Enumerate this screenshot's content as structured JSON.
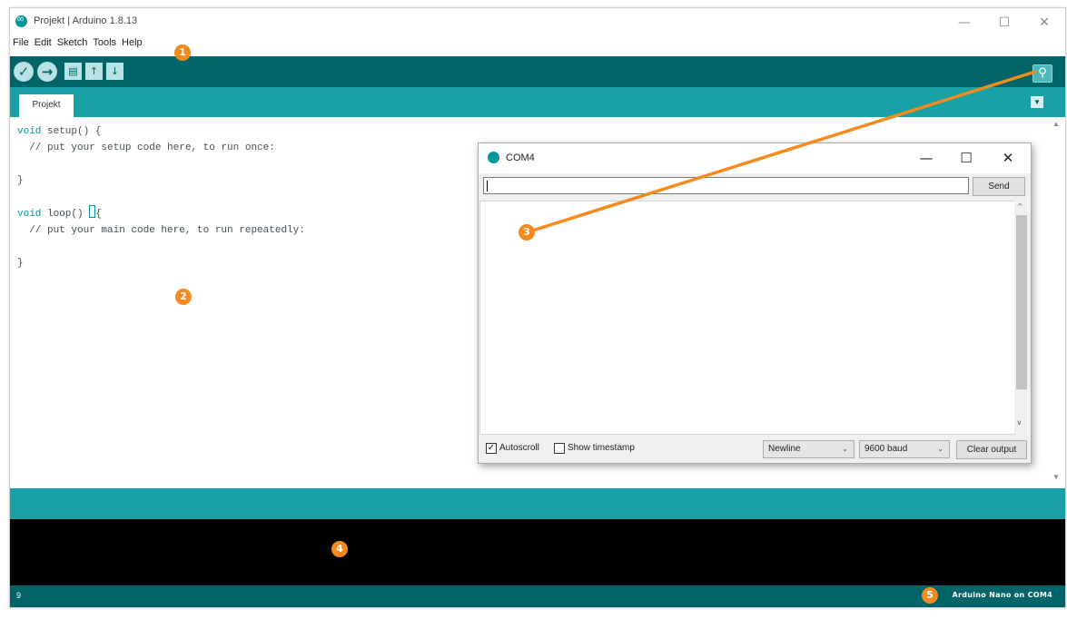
{
  "window": {
    "title": "Projekt | Arduino 1.8.13",
    "minimize": "—",
    "maximize": "☐",
    "close": "✕"
  },
  "menu": [
    "File",
    "Edit",
    "Sketch",
    "Tools",
    "Help"
  ],
  "toolbar": {
    "verify_icon": "✓",
    "upload_icon": "→",
    "new_icon": "▤",
    "open_icon": "↑",
    "save_icon": "↓",
    "serial_monitor_icon": "⚲"
  },
  "tabs": [
    {
      "label": "Projekt"
    }
  ],
  "tab_menu_icon": "▼",
  "editor": {
    "lines": [
      "void setup() {",
      "  // put your setup code here, to run once:",
      "",
      "}",
      "",
      "void loop() {",
      "  // put your main code here, to run repeatedly:",
      "",
      "}"
    ]
  },
  "status": {
    "line_number": "9",
    "board": "Arduino Nano on COM4"
  },
  "serial_monitor": {
    "title": "COM4",
    "minimize": "—",
    "maximize": "☐",
    "close": "✕",
    "input_value": "",
    "send_label": "Send",
    "autoscroll_label": "Autoscroll",
    "autoscroll_checked": true,
    "autoscroll_mark": "✓",
    "timestamp_label": "Show timestamp",
    "timestamp_checked": false,
    "line_ending": "Newline",
    "baud": "9600 baud",
    "clear_label": "Clear output",
    "scroll_up": "^",
    "scroll_down": "v"
  },
  "annotations": [
    "1",
    "2",
    "3",
    "4",
    "5"
  ],
  "colors": {
    "toolbar": "#006468",
    "tabstrip": "#17a1a5",
    "badge": "#f38b1e",
    "console": "#000000"
  }
}
